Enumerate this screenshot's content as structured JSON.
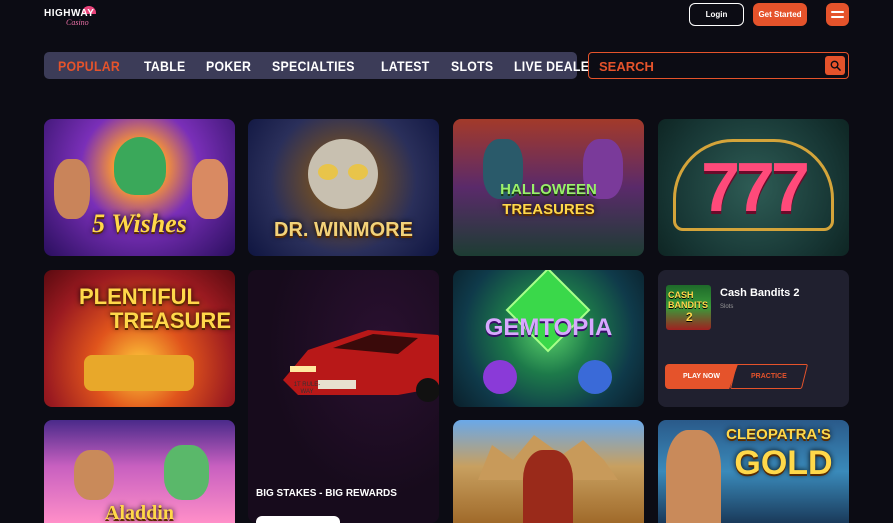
{
  "header": {
    "logo_top": "HIGHWAY",
    "logo_bottom": "Casino",
    "login_label": "Login",
    "get_started_label": "Get Started"
  },
  "nav": {
    "tabs": [
      "POPULAR",
      "TABLE",
      "POKER",
      "SPECIALTIES",
      "LATEST",
      "SLOTS",
      "LIVE DEALER"
    ],
    "active_tab": "POPULAR"
  },
  "search": {
    "placeholder": "SEARCH"
  },
  "games": {
    "five_wishes": {
      "logo_text": "5 Wishes"
    },
    "dr_winmore": {
      "logo_text": "DR. WINMORE"
    },
    "halloween": {
      "logo_text_1": "HALLOWEEN",
      "logo_text_2": "TREASURES"
    },
    "sevens": {
      "logo_text": "777"
    },
    "plentiful": {
      "logo_text_1": "PLENTIFUL",
      "logo_text_2": "TREASURE"
    },
    "gemtopia": {
      "logo_text": "GEMTOPIA"
    },
    "aladdin": {
      "logo_text": "Aladdin"
    },
    "cleopatra": {
      "logo_text_1": "CLEOPATRA'S",
      "logo_text_2": "GOLD"
    }
  },
  "promo": {
    "headline": "BIG STAKES - BIG REWARDS",
    "plate_text": "1T RULE-WAY"
  },
  "featured": {
    "name": "Cash Bandits 2",
    "category": "Slots",
    "thumb_text_1": "CASH",
    "thumb_text_2": "BANDITS",
    "thumb_text_3": "2",
    "play_label": "PLAY NOW",
    "practice_label": "PRACTICE"
  },
  "colors": {
    "accent": "#e5532b",
    "background": "#0c0c14",
    "nav_bg": "#3c3c58",
    "card_bg": "#20202f"
  }
}
